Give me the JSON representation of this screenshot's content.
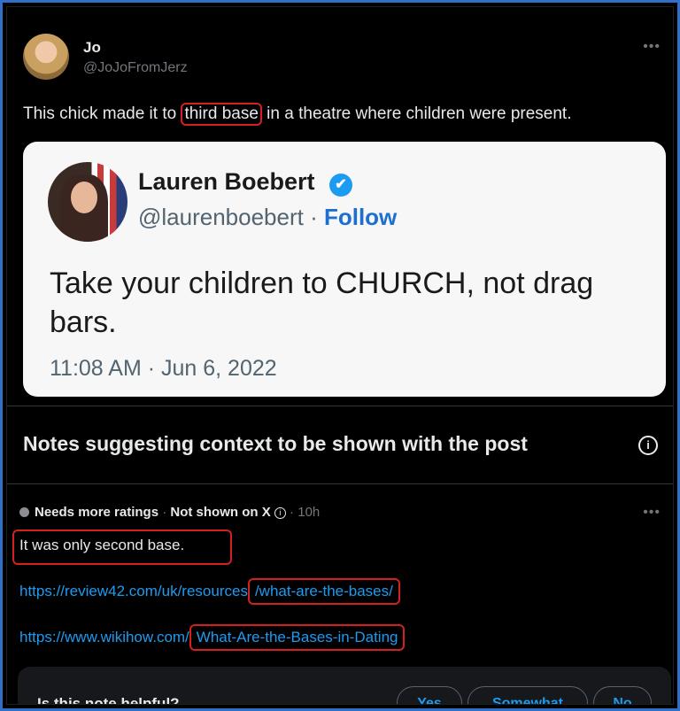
{
  "post": {
    "author_name": "Jo",
    "author_handle": "@JoJoFromJerz",
    "more_label": "•••",
    "text_before": "This chick made it to ",
    "text_highlight": "third base",
    "text_after": " in a theatre where children were present."
  },
  "quoted": {
    "name": "Lauren Boebert",
    "handle": "@laurenboebert",
    "separator": " · ",
    "follow_label": "Follow",
    "text": "Take your children to CHURCH, not drag bars.",
    "timestamp": "11:08 AM · Jun 6, 2022",
    "verified_icon": "✔"
  },
  "notes": {
    "title": "Notes suggesting context to be shown with the post",
    "info_icon": "i",
    "status": "Needs more ratings",
    "separator1": " · ",
    "visibility": "Not shown on X",
    "separator2": " · ",
    "age": "10h",
    "more_label": "•••",
    "note_text": "It was only second base.",
    "link1_prefix": "https://review42.com/uk/resources",
    "link1_highlight": "/what-are-the-bases/",
    "link2_prefix": "https://www.wikihow.com/",
    "link2_highlight": "What-Are-the-Bases-in-Dating",
    "helpful_question": "Is this note helpful?",
    "buttons": [
      "Yes",
      "Somewhat",
      "No"
    ]
  },
  "colors": {
    "accent": "#1d9bf0",
    "highlight_border": "#d42020",
    "frame_border": "#2f6fc8"
  }
}
